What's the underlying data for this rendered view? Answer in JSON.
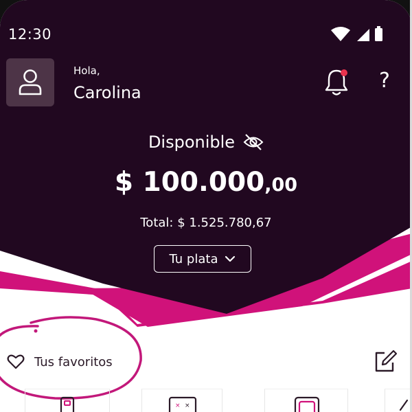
{
  "status_bar": {
    "time": "12:30",
    "icons": [
      "wifi-icon",
      "signal-icon",
      "battery-icon"
    ]
  },
  "header": {
    "greeting": "Hola,",
    "user_name": "Carolina",
    "icons": [
      "user-icon",
      "bell-icon",
      "help-icon"
    ],
    "notification_dot": true,
    "help_label": "?"
  },
  "balance": {
    "label": "Disponible",
    "amount_main": "$ 100.000",
    "amount_cents": ",00",
    "total_text": "Total: $ 1.525.780,67",
    "toggle_icon": "eye-slash-icon"
  },
  "account_selector": {
    "label": "Tu plata",
    "icon": "chevron-down-icon"
  },
  "favorites": {
    "label": "Tus favoritos",
    "icon": "heart-icon",
    "edit_icon": "edit-icon"
  },
  "colors": {
    "header_bg": "#210820",
    "accent": "#d0127a",
    "avatar_bg": "#4d3447",
    "text_dark": "#2b1a28",
    "notification": "#e8334e"
  }
}
